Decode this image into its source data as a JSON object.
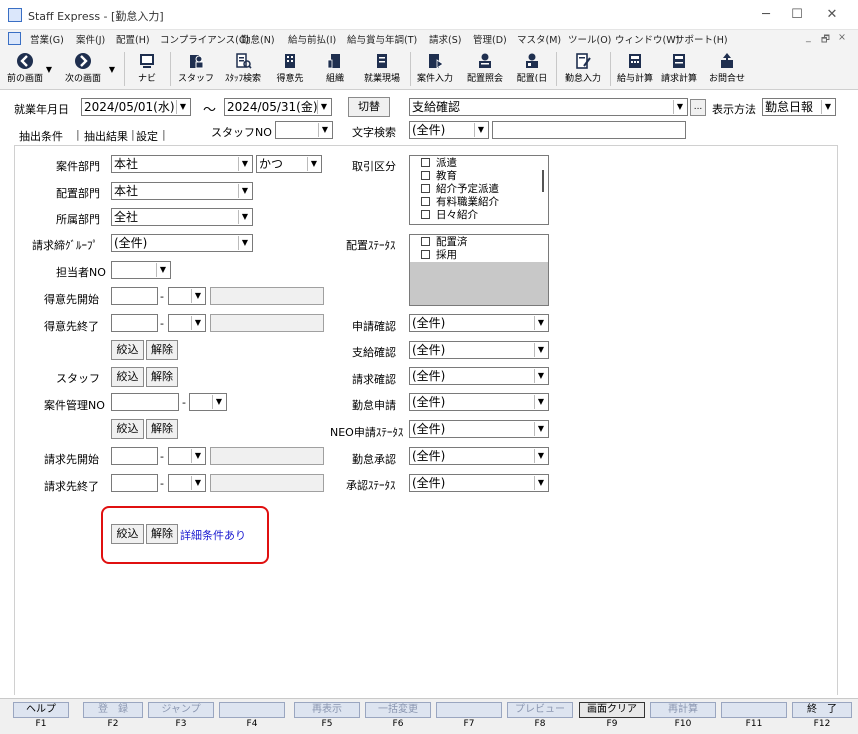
{
  "window": {
    "title": "Staff Express - [勤怠入力]"
  },
  "menu": [
    "営業(G)",
    "案件(J)",
    "配置(H)",
    "コンプライアンス(C)",
    "勤怠(N)",
    "給与前払(I)",
    "給与賞与年調(T)",
    "請求(S)",
    "管理(D)",
    "マスタ(M)",
    "ツール(O)",
    "ウィンドウ(W)",
    "サポート(H)"
  ],
  "toolbar": {
    "prev": "前の画面",
    "next": "次の画面",
    "navi": "ナビ",
    "staff": "スタッフ",
    "staff_search": "ｽﾀｯﾌ検索",
    "client": "得意先",
    "org": "組織",
    "site": "就業現場",
    "job_input": "案件入力",
    "placement_view": "配置照会",
    "placement_day": "配置(日",
    "attendance_input": "勤怠入力",
    "payroll_calc": "給与計算",
    "billing_calc": "請求計算",
    "contact": "お問合せ"
  },
  "header": {
    "period_label": "就業年月日",
    "date_from": "2024/05/01(水)",
    "tilde": "～",
    "date_to": "2024/05/31(金)",
    "switch_button": "切替",
    "mode_select": "支給確認",
    "ellipsis": "...",
    "display_method_label": "表示方法",
    "display_method": "勤怠日報"
  },
  "tabs": {
    "extract": "抽出条件",
    "result": "抽出結果",
    "settings": "設定"
  },
  "staff_no_label": "スタッフNO",
  "text_search_label": "文字検索",
  "text_search_value": "(全件)",
  "left": {
    "job_dept_label": "案件部門",
    "job_dept": "本社",
    "conj": "かつ",
    "placement_dept_label": "配置部門",
    "placement_dept": "本社",
    "own_dept_label": "所属部門",
    "own_dept": "全社",
    "billing_group_label": "請求締ｸﾞﾙｰﾌﾟ",
    "billing_group": "(全件)",
    "person_no_label": "担当者NO",
    "client_start_label": "得意先開始",
    "client_end_label": "得意先終了",
    "narrow_button": "絞込",
    "clear_button": "解除",
    "staff_label": "スタッフ",
    "job_mgmt_label": "案件管理NO",
    "bill_start_label": "請求先開始",
    "bill_end_label": "請求先終了",
    "dash": "-",
    "detail_link": "詳細条件あり"
  },
  "right": {
    "trade_label": "取引区分",
    "trade_items": [
      "派遣",
      "教育",
      "紹介予定派遣",
      "有料職業紹介",
      "日々紹介"
    ],
    "placement_status_label": "配置ｽﾃｰﾀｽ",
    "placement_status_items": [
      "配置済",
      "採用"
    ],
    "filters": [
      {
        "label": "申請確認",
        "value": "(全件)"
      },
      {
        "label": "支給確認",
        "value": "(全件)"
      },
      {
        "label": "請求確認",
        "value": "(全件)"
      },
      {
        "label": "勤怠申請",
        "value": "(全件)"
      },
      {
        "label": "NEO申請ｽﾃｰﾀｽ",
        "value": "(全件)"
      },
      {
        "label": "勤怠承認",
        "value": "(全件)"
      },
      {
        "label": "承認ｽﾃｰﾀｽ",
        "value": "(全件)"
      }
    ]
  },
  "fkeys": [
    {
      "label": "ヘルプ",
      "key": "F1"
    },
    {
      "label": "登　録",
      "key": "F2"
    },
    {
      "label": "ジャンプ",
      "key": "F3"
    },
    {
      "label": "",
      "key": "F4"
    },
    {
      "label": "再表示",
      "key": "F5"
    },
    {
      "label": "一括変更",
      "key": "F6"
    },
    {
      "label": "",
      "key": "F7"
    },
    {
      "label": "プレビュー",
      "key": "F8"
    },
    {
      "label": "画面クリア",
      "key": "F9"
    },
    {
      "label": "再計算",
      "key": "F10"
    },
    {
      "label": "",
      "key": "F11"
    },
    {
      "label": "終　了",
      "key": "F12"
    }
  ],
  "colors": {
    "highlight": "#e01010",
    "link": "#1a1ad0",
    "toolbar_icon": "#1f2f4f"
  }
}
